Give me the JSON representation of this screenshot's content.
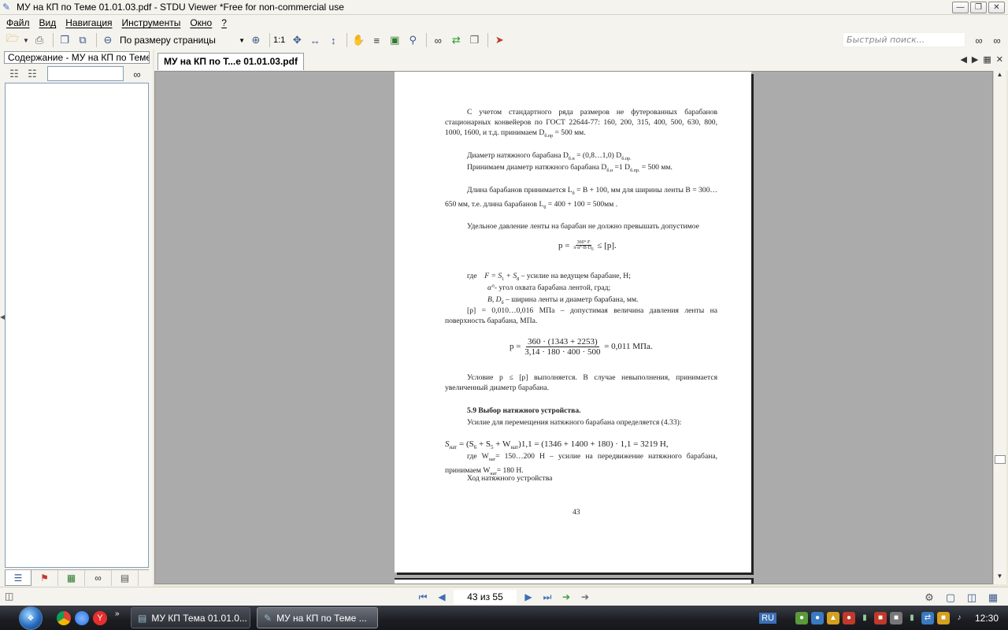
{
  "window": {
    "title": "МУ на КП по Теме 01.01.03.pdf - STDU Viewer *Free for non-commercial use"
  },
  "menu": {
    "items": [
      "Файл",
      "Вид",
      "Навигация",
      "Инструменты",
      "Окно",
      "?"
    ]
  },
  "toolbar": {
    "zoom_value": "По размеру страницы",
    "actual_size_label": "1:1",
    "quick_search_placeholder": "Быстрый поиск..."
  },
  "left_panel": {
    "tab_label": "Содержание - МУ на КП по Теме"
  },
  "document": {
    "tab_label": "МУ на КП по Т...е 01.01.03.pdf"
  },
  "page_content": {
    "p1": "С учетом стандартного ряда размеров не футерованных барабанов стационарных конвейеров по ГОСТ 22644-77: 160, 200, 315, 400, 500, 630, 800, 1000, 1600, и т.д. принимаем D",
    "p1_sub": "б.пр",
    "p1_tail": " = 500 мм.",
    "p2": "Диаметр натяжного барабана D",
    "p2_sub": "б.н",
    "p2_mid": " = (0,8…1,0) D",
    "p2_sub2": "б.пр.",
    "p3": "Принимаем диаметр натяжного барабана D",
    "p3_sub": "б.н",
    "p3_mid": " =1 D",
    "p3_sub2": "б.пр.",
    "p3_tail": " = 500 мм.",
    "p4": "Длина барабанов принимается  L",
    "p4_sub": "б",
    "p4_mid": " = B + 100, мм  для ширины ленты В = 300…650 мм, т.е. длина барабанов  L",
    "p4_sub2": "б",
    "p4_tail": " = 400 + 100 = 500мм .",
    "p5": "Удельное давление ленты на барабан не должно превышать допустимое",
    "f1_left": "p =",
    "f1_num": "360°·F",
    "f1_den": "π·α°·B·D",
    "f1_den_sub": "б",
    "f1_right": "≤ [p].",
    "where_label": "где",
    "w1": "F = S",
    "w1_sub": "1",
    "w1_mid": " + S",
    "w1_sub2": "8",
    "w1_tail": " – усилие на ведущем барабане, Н;",
    "w2": "α°",
    "w2_tail": "- угол охвата барабана лентой, град;",
    "w3": "B, D",
    "w3_sub": "б",
    "w3_tail": " – ширина ленты и диаметр барабана, мм.",
    "p6": "[p] = 0,010…0,016 МПа – допустимая величина давления ленты на поверхность барабана, МПа.",
    "f2_left": "p =",
    "f2_num": "360 · (1343 + 2253)",
    "f2_den": "3,14 · 180 · 400 · 500",
    "f2_right": "= 0,011 МПа.",
    "p7": "Условие p ≤ [p] выполняется. В случае невыполнения, принимается увеличенный диаметр барабана.",
    "h1": "5.9 Выбор натяжного устройства.",
    "p8": "Усилие для перемещения натяжного барабана определяется (4.33):",
    "f3": "S",
    "f3_sub": "нат",
    "f3_mid": " = (S",
    "f3_sub2": "6",
    "f3_mid2": " + S",
    "f3_sub3": "5",
    "f3_mid3": " + W",
    "f3_sub4": "нат",
    "f3_tail": ")1,1 = (1346 + 1400 + 180) · 1,1 = 3219 Н,",
    "p9": "где W",
    "p9_sub": "нат",
    "p9_tail": "= 150…200 Н – усилие на передвижение натяжного барабана, принимаем W",
    "p9_sub2": "нат",
    "p9_tail2": "= 180 Н.",
    "p10": "Ход натяжного устройства",
    "page_number": "43"
  },
  "statusbar": {
    "page_indicator": "43 из 55"
  },
  "taskbar": {
    "tasks": [
      "МУ КП Тема 01.01.0...",
      "МУ на КП по Теме ..."
    ],
    "lang": "RU",
    "clock": "12:30"
  }
}
